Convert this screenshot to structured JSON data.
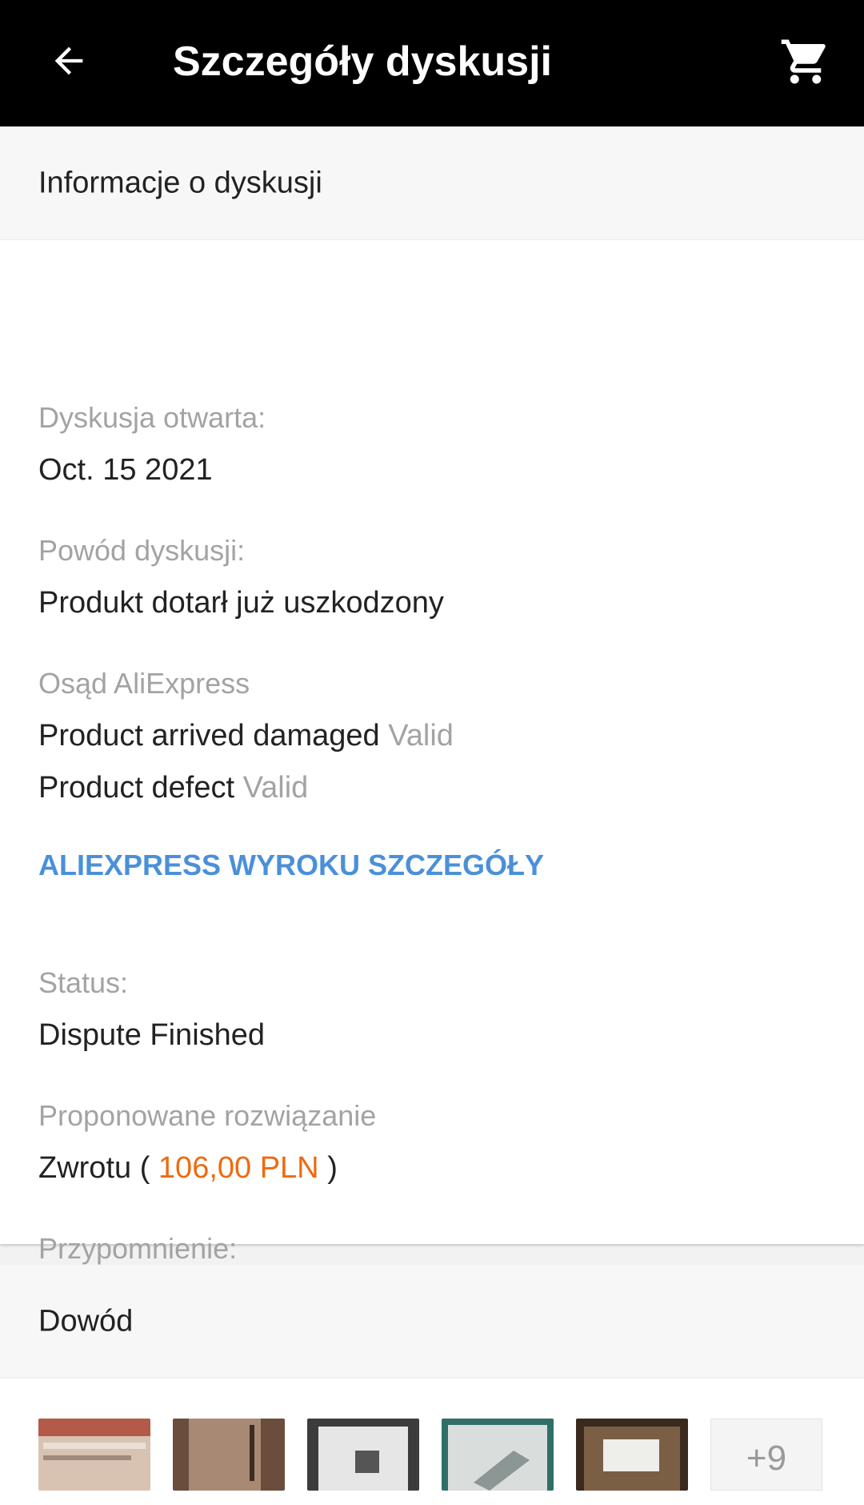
{
  "header": {
    "title": "Szczegóły dyskusji",
    "back_icon": "arrow-left-icon",
    "cart_icon": "shopping-cart-icon"
  },
  "info_section": {
    "title": "Informacje o dyskusji",
    "opened_label": "Dyskusja otwarta:",
    "opened_value": "Oct. 15 2021",
    "reason_label": "Powód dyskusji:",
    "reason_value": "Produkt dotarł już uszkodzony",
    "verdict_label": "Osąd AliExpress",
    "verdicts": [
      {
        "text": "Product arrived damaged",
        "status": "Valid"
      },
      {
        "text": "Product defect",
        "status": "Valid"
      }
    ],
    "details_link": "ALIEXPRESS WYROKU SZCZEGÓŁY",
    "status_label": "Status:",
    "status_value": "Dispute Finished",
    "solution_label": "Proponowane rozwiązanie",
    "solution_prefix": "Zwrotu (",
    "solution_amount": "106,00 PLN",
    "solution_suffix": ")",
    "reminder_label": "Przypomnienie:"
  },
  "evidence_section": {
    "title": "Dowód",
    "thumbnails": [
      {
        "name": "evidence-photo-1",
        "color": "#c9a48e"
      },
      {
        "name": "evidence-photo-2",
        "color": "#8a6a58"
      },
      {
        "name": "evidence-photo-3",
        "color": "#c8c8c8"
      },
      {
        "name": "evidence-photo-4",
        "color": "#9ab0ab"
      },
      {
        "name": "evidence-photo-5",
        "color": "#6d5a48"
      }
    ],
    "more_label": "+9"
  },
  "colors": {
    "header_bg": "#000000",
    "link": "#4a90d9",
    "price": "#ee6a10",
    "muted_text": "#a3a3a3"
  }
}
